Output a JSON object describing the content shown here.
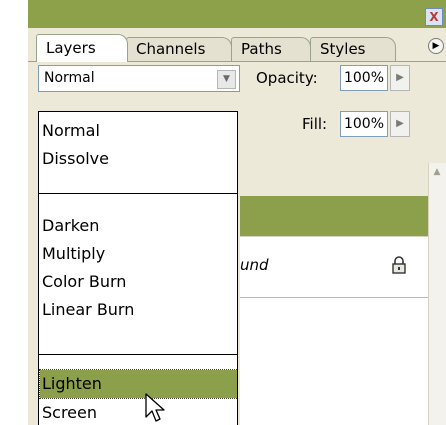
{
  "window": {
    "close_glyph": "X"
  },
  "tabs": [
    {
      "label": "Layers"
    },
    {
      "label": "Channels"
    },
    {
      "label": "Paths"
    },
    {
      "label": "Styles"
    }
  ],
  "panel_menu_icon": "flyout-menu-icon",
  "blend_mode": {
    "value": "Normal",
    "options": [
      "Normal",
      "Dissolve",
      "Darken",
      "Multiply",
      "Color Burn",
      "Linear Burn",
      "Lighten",
      "Screen"
    ],
    "highlighted": "Lighten"
  },
  "opacity": {
    "label": "Opacity:",
    "value": "100%"
  },
  "fill": {
    "label": "Fill:",
    "value": "100%"
  },
  "layers": [
    {
      "name": "",
      "selected": true
    },
    {
      "name": "und",
      "locked": true,
      "lock_icon": "lock-icon"
    }
  ],
  "colors": {
    "accent": "#8ca04b",
    "panel": "#ece9d8"
  }
}
